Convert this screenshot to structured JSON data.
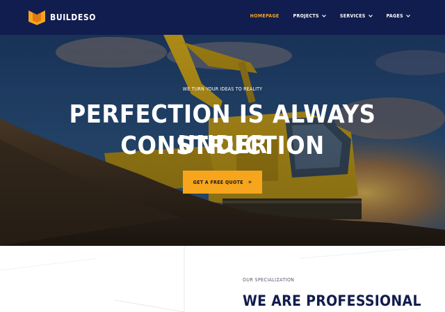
{
  "header": {
    "brand": "BUILDESO",
    "nav": [
      {
        "label": "HOMEPAGE",
        "active": true,
        "dropdown": false
      },
      {
        "label": "PROJECTS",
        "active": false,
        "dropdown": true
      },
      {
        "label": "SERVICES",
        "active": false,
        "dropdown": true
      },
      {
        "label": "PAGES",
        "active": false,
        "dropdown": true
      }
    ]
  },
  "hero": {
    "eyebrow": "WE TURN YOUR IDEAS TO REALITY",
    "headline_line1": "PERFECTION IS ALWAYS UNDER",
    "headline_line2": "CONSTRUCTION",
    "cta_label": "GET A FREE QUOTE",
    "cta_icon": "double-chevron-right-icon"
  },
  "section": {
    "eyebrow": "OUR SPECIALIZATION",
    "title": "WE ARE PROFESSIONAL"
  },
  "colors": {
    "navy": "#111d4e",
    "accent": "#f7a51d",
    "active_nav": "#f5a623"
  }
}
